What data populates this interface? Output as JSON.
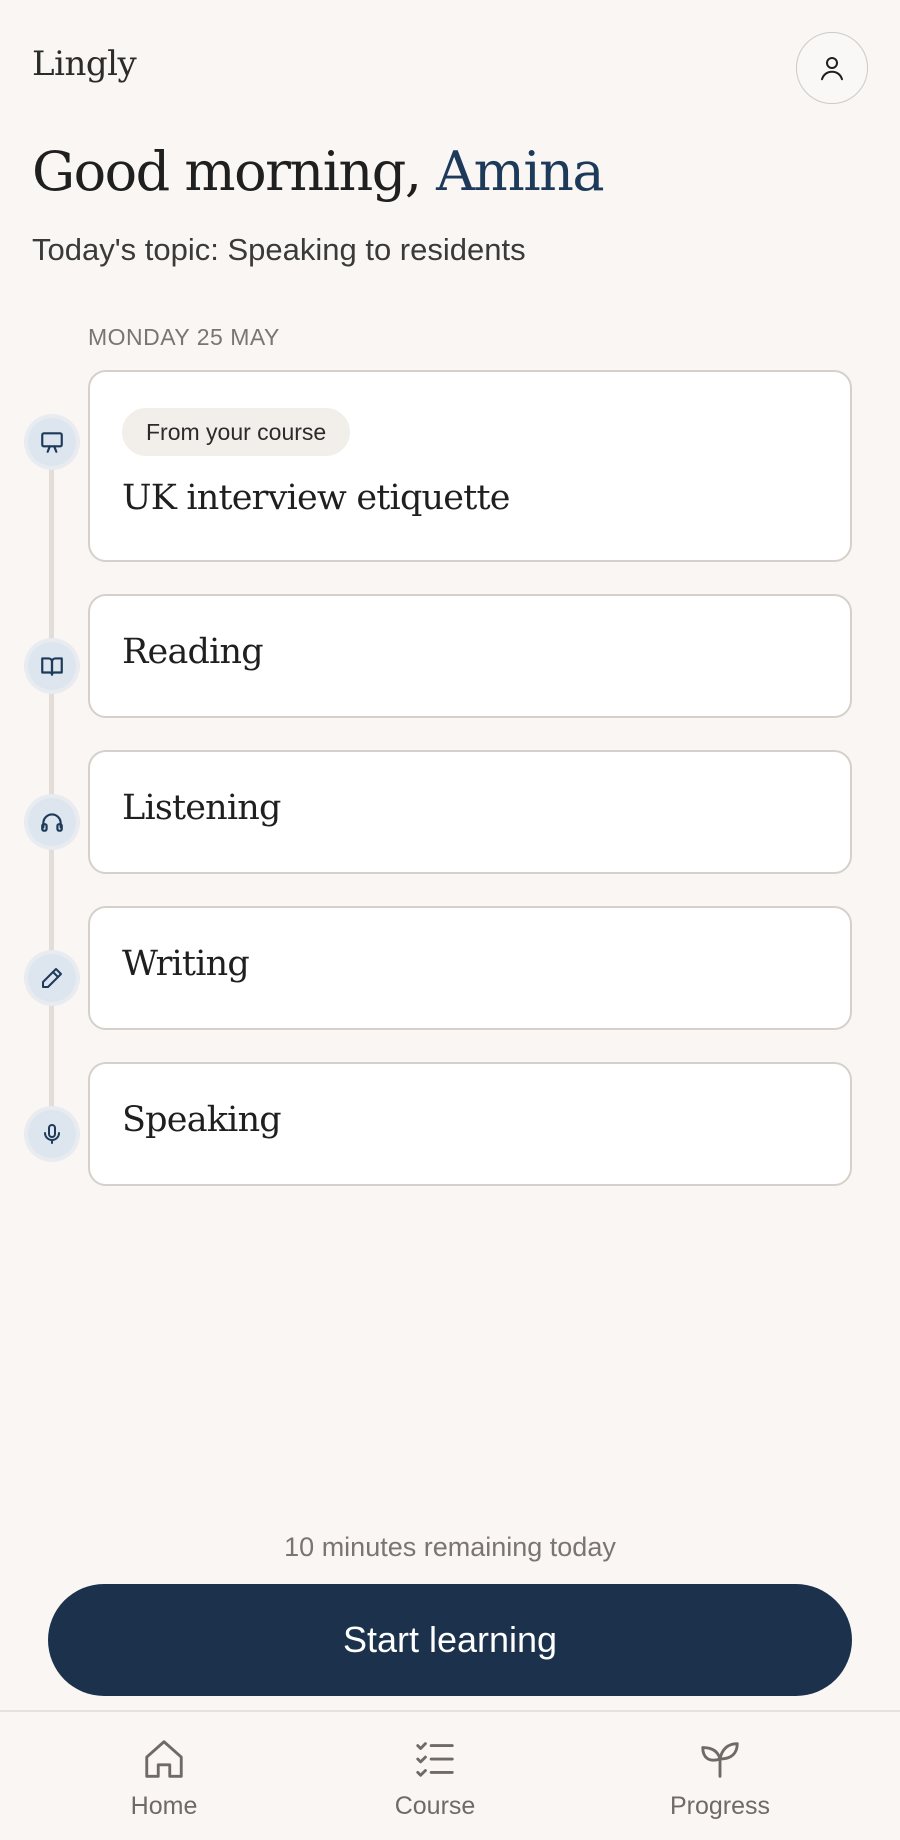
{
  "app": {
    "logo": "Lingly"
  },
  "greeting": {
    "prefix": "Good morning, ",
    "name": "Amina"
  },
  "topic": "Today's topic: Speaking to residents",
  "date_label": "MONDAY 25 MAY",
  "activities": [
    {
      "chip": "From your course",
      "title": "UK interview etiquette",
      "icon": "presentation-icon"
    },
    {
      "title": "Reading",
      "icon": "book-icon"
    },
    {
      "title": "Listening",
      "icon": "headphones-icon"
    },
    {
      "title": "Writing",
      "icon": "pencil-icon"
    },
    {
      "title": "Speaking",
      "icon": "microphone-icon"
    }
  ],
  "remaining": "10 minutes remaining today",
  "start_button": "Start learning",
  "nav": [
    {
      "label": "Home",
      "icon": "home-icon"
    },
    {
      "label": "Course",
      "icon": "checklist-icon"
    },
    {
      "label": "Progress",
      "icon": "sprout-icon"
    }
  ],
  "colors": {
    "accent": "#1b314c",
    "name_accent": "#1d3a5a",
    "background": "#f9f6f3"
  }
}
